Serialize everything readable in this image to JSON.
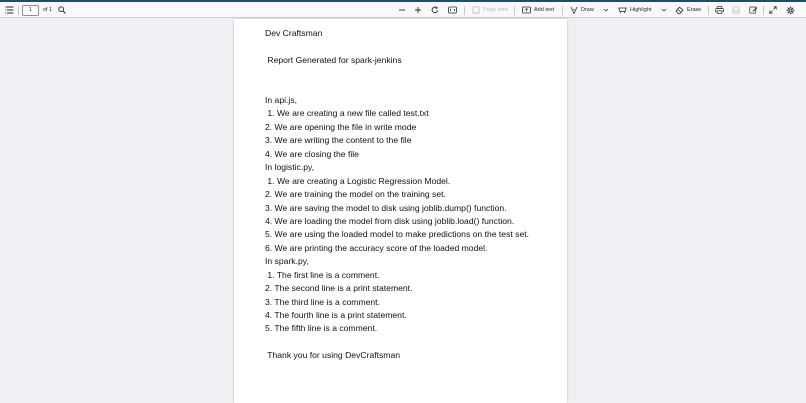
{
  "toolbar": {
    "page_number": "1",
    "page_of": "of 1",
    "page_view_label": "Page view",
    "add_text_label": "Add text",
    "draw_label": "Draw",
    "highlight_label": "Highlight",
    "erase_label": "Erase"
  },
  "document": {
    "lines": [
      "Dev Craftsman",
      " Report Generated for spark-jenkins",
      "In api.js,",
      " 1. We are creating a new file called test.txt",
      "2. We are opening the file in write mode",
      "3. We are writing the content to the file",
      "4. We are closing the file",
      "In logistic.py,",
      " 1. We are creating a Logistic Regression Model.",
      "2. We are training the model on the training set.",
      "3. We are saving the model to disk using joblib.dump() function.",
      "4. We are loading the model from disk using joblib.load() function.",
      "5. We are using the loaded model to make predictions on the test set.",
      "6. We are printing the accuracy score of the loaded model.",
      "In spark.py,",
      " 1. The first line is a comment.",
      "2. The second line is a print statement.",
      "3. The third line is a comment.",
      "4. The fourth line is a print statement.",
      "5. The fifth line is a comment.",
      " Thank you for using DevCraftsman"
    ]
  }
}
